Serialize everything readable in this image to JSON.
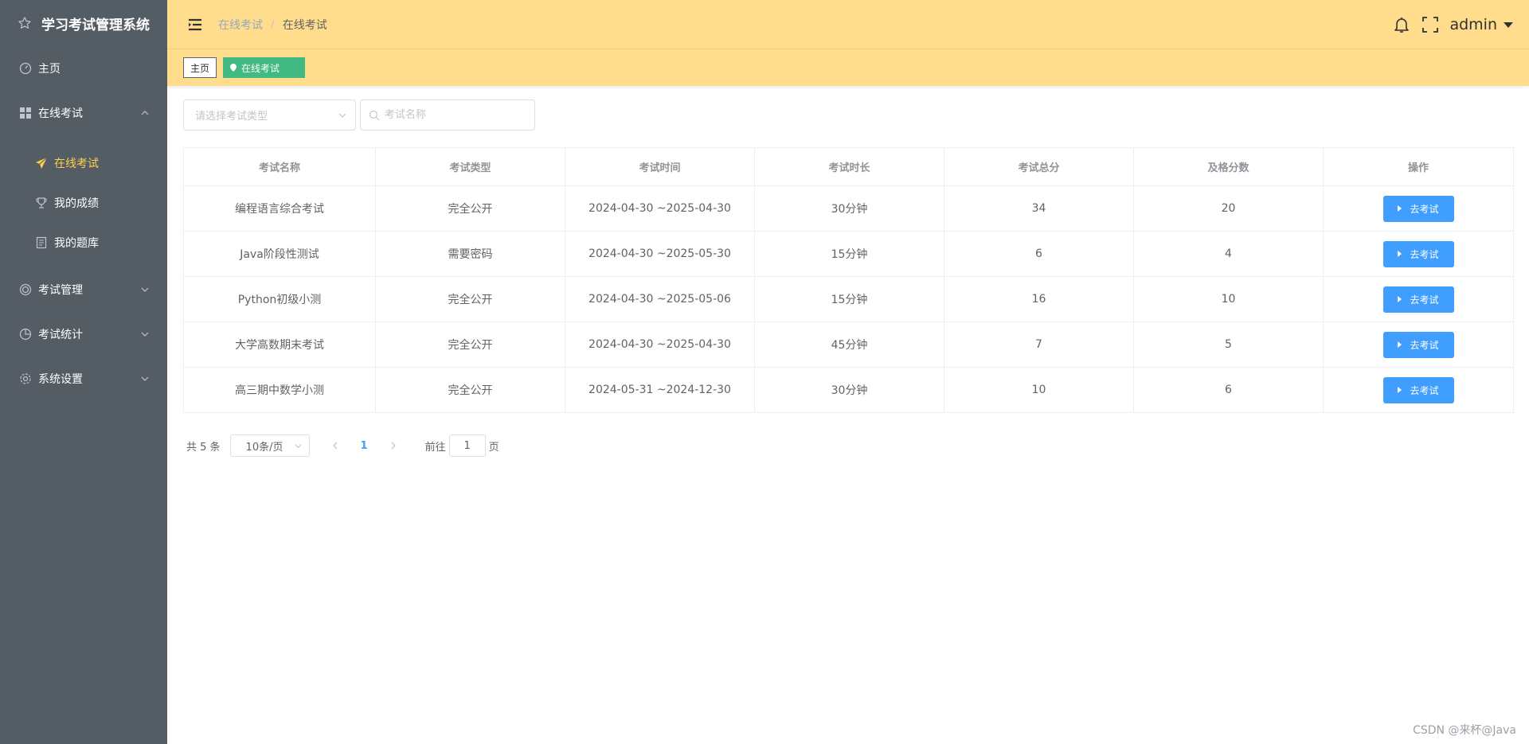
{
  "app": {
    "title": "学习考试管理系统"
  },
  "sidebar": {
    "items": [
      {
        "label": "主页",
        "icon": "dashboard-icon"
      },
      {
        "label": "在线考试",
        "icon": "grid-icon",
        "expanded": true,
        "children": [
          {
            "label": "在线考试",
            "icon": "paper-plane-icon",
            "active": true
          },
          {
            "label": "我的成绩",
            "icon": "trophy-icon"
          },
          {
            "label": "我的题库",
            "icon": "notebook-icon"
          }
        ]
      },
      {
        "label": "考试管理",
        "icon": "target-icon"
      },
      {
        "label": "考试统计",
        "icon": "pie-chart-icon"
      },
      {
        "label": "系统设置",
        "icon": "gear-icon"
      }
    ],
    "active_color": "#ffd04b",
    "bg_color": "#545c64"
  },
  "header": {
    "breadcrumb": [
      "在线考试",
      "在线考试"
    ],
    "breadcrumb_sep": "/",
    "user": "admin",
    "bg_color": "#ffdd8c"
  },
  "tags": {
    "home": "主页",
    "active": "在线考试",
    "active_color": "#42b983"
  },
  "filters": {
    "type_placeholder": "请选择考试类型",
    "name_placeholder": "考试名称"
  },
  "table": {
    "columns": [
      "考试名称",
      "考试类型",
      "考试时间",
      "考试时长",
      "考试总分",
      "及格分数",
      "操作"
    ],
    "rows": [
      [
        "编程语言综合考试",
        "完全公开",
        "2024-04-30 ~2025-04-30",
        "30分钟",
        "34",
        "20"
      ],
      [
        "Java阶段性测试",
        "需要密码",
        "2024-04-30 ~2025-05-30",
        "15分钟",
        "6",
        "4"
      ],
      [
        "Python初级小测",
        "完全公开",
        "2024-04-30 ~2025-05-06",
        "15分钟",
        "16",
        "10"
      ],
      [
        "大学高数期末考试",
        "完全公开",
        "2024-04-30 ~2025-04-30",
        "45分钟",
        "7",
        "5"
      ],
      [
        "高三期中数学小测",
        "完全公开",
        "2024-05-31 ~2024-12-30",
        "30分钟",
        "10",
        "6"
      ]
    ],
    "action_label": "去考试",
    "action_color": "#409eff"
  },
  "pagination": {
    "total": "共 5 条",
    "page_size": "10条/页",
    "current_page": "1",
    "goto_prefix": "前往",
    "goto_value": "1",
    "goto_suffix": "页"
  },
  "watermark": "CSDN @来杯@Java"
}
